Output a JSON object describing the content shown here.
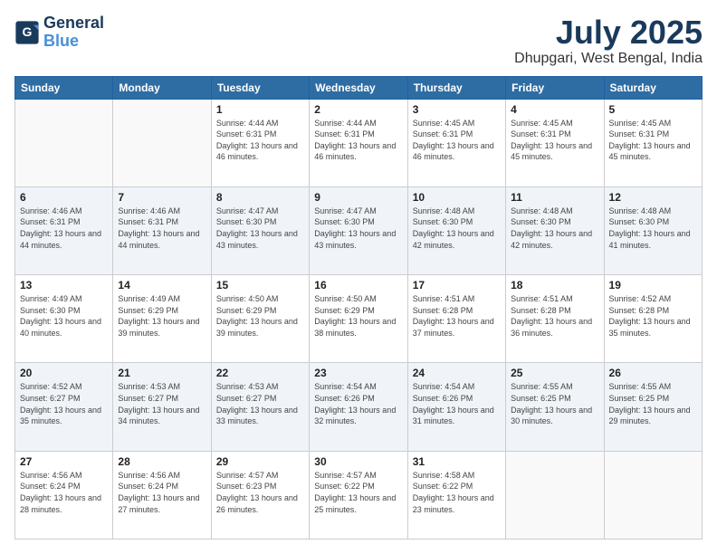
{
  "header": {
    "logo_line1": "General",
    "logo_line2": "Blue",
    "month": "July 2025",
    "location": "Dhupgari, West Bengal, India"
  },
  "weekdays": [
    "Sunday",
    "Monday",
    "Tuesday",
    "Wednesday",
    "Thursday",
    "Friday",
    "Saturday"
  ],
  "weeks": [
    [
      {
        "day": "",
        "info": ""
      },
      {
        "day": "",
        "info": ""
      },
      {
        "day": "1",
        "info": "Sunrise: 4:44 AM\nSunset: 6:31 PM\nDaylight: 13 hours and 46 minutes."
      },
      {
        "day": "2",
        "info": "Sunrise: 4:44 AM\nSunset: 6:31 PM\nDaylight: 13 hours and 46 minutes."
      },
      {
        "day": "3",
        "info": "Sunrise: 4:45 AM\nSunset: 6:31 PM\nDaylight: 13 hours and 46 minutes."
      },
      {
        "day": "4",
        "info": "Sunrise: 4:45 AM\nSunset: 6:31 PM\nDaylight: 13 hours and 45 minutes."
      },
      {
        "day": "5",
        "info": "Sunrise: 4:45 AM\nSunset: 6:31 PM\nDaylight: 13 hours and 45 minutes."
      }
    ],
    [
      {
        "day": "6",
        "info": "Sunrise: 4:46 AM\nSunset: 6:31 PM\nDaylight: 13 hours and 44 minutes."
      },
      {
        "day": "7",
        "info": "Sunrise: 4:46 AM\nSunset: 6:31 PM\nDaylight: 13 hours and 44 minutes."
      },
      {
        "day": "8",
        "info": "Sunrise: 4:47 AM\nSunset: 6:30 PM\nDaylight: 13 hours and 43 minutes."
      },
      {
        "day": "9",
        "info": "Sunrise: 4:47 AM\nSunset: 6:30 PM\nDaylight: 13 hours and 43 minutes."
      },
      {
        "day": "10",
        "info": "Sunrise: 4:48 AM\nSunset: 6:30 PM\nDaylight: 13 hours and 42 minutes."
      },
      {
        "day": "11",
        "info": "Sunrise: 4:48 AM\nSunset: 6:30 PM\nDaylight: 13 hours and 42 minutes."
      },
      {
        "day": "12",
        "info": "Sunrise: 4:48 AM\nSunset: 6:30 PM\nDaylight: 13 hours and 41 minutes."
      }
    ],
    [
      {
        "day": "13",
        "info": "Sunrise: 4:49 AM\nSunset: 6:30 PM\nDaylight: 13 hours and 40 minutes."
      },
      {
        "day": "14",
        "info": "Sunrise: 4:49 AM\nSunset: 6:29 PM\nDaylight: 13 hours and 39 minutes."
      },
      {
        "day": "15",
        "info": "Sunrise: 4:50 AM\nSunset: 6:29 PM\nDaylight: 13 hours and 39 minutes."
      },
      {
        "day": "16",
        "info": "Sunrise: 4:50 AM\nSunset: 6:29 PM\nDaylight: 13 hours and 38 minutes."
      },
      {
        "day": "17",
        "info": "Sunrise: 4:51 AM\nSunset: 6:28 PM\nDaylight: 13 hours and 37 minutes."
      },
      {
        "day": "18",
        "info": "Sunrise: 4:51 AM\nSunset: 6:28 PM\nDaylight: 13 hours and 36 minutes."
      },
      {
        "day": "19",
        "info": "Sunrise: 4:52 AM\nSunset: 6:28 PM\nDaylight: 13 hours and 35 minutes."
      }
    ],
    [
      {
        "day": "20",
        "info": "Sunrise: 4:52 AM\nSunset: 6:27 PM\nDaylight: 13 hours and 35 minutes."
      },
      {
        "day": "21",
        "info": "Sunrise: 4:53 AM\nSunset: 6:27 PM\nDaylight: 13 hours and 34 minutes."
      },
      {
        "day": "22",
        "info": "Sunrise: 4:53 AM\nSunset: 6:27 PM\nDaylight: 13 hours and 33 minutes."
      },
      {
        "day": "23",
        "info": "Sunrise: 4:54 AM\nSunset: 6:26 PM\nDaylight: 13 hours and 32 minutes."
      },
      {
        "day": "24",
        "info": "Sunrise: 4:54 AM\nSunset: 6:26 PM\nDaylight: 13 hours and 31 minutes."
      },
      {
        "day": "25",
        "info": "Sunrise: 4:55 AM\nSunset: 6:25 PM\nDaylight: 13 hours and 30 minutes."
      },
      {
        "day": "26",
        "info": "Sunrise: 4:55 AM\nSunset: 6:25 PM\nDaylight: 13 hours and 29 minutes."
      }
    ],
    [
      {
        "day": "27",
        "info": "Sunrise: 4:56 AM\nSunset: 6:24 PM\nDaylight: 13 hours and 28 minutes."
      },
      {
        "day": "28",
        "info": "Sunrise: 4:56 AM\nSunset: 6:24 PM\nDaylight: 13 hours and 27 minutes."
      },
      {
        "day": "29",
        "info": "Sunrise: 4:57 AM\nSunset: 6:23 PM\nDaylight: 13 hours and 26 minutes."
      },
      {
        "day": "30",
        "info": "Sunrise: 4:57 AM\nSunset: 6:22 PM\nDaylight: 13 hours and 25 minutes."
      },
      {
        "day": "31",
        "info": "Sunrise: 4:58 AM\nSunset: 6:22 PM\nDaylight: 13 hours and 23 minutes."
      },
      {
        "day": "",
        "info": ""
      },
      {
        "day": "",
        "info": ""
      }
    ]
  ]
}
